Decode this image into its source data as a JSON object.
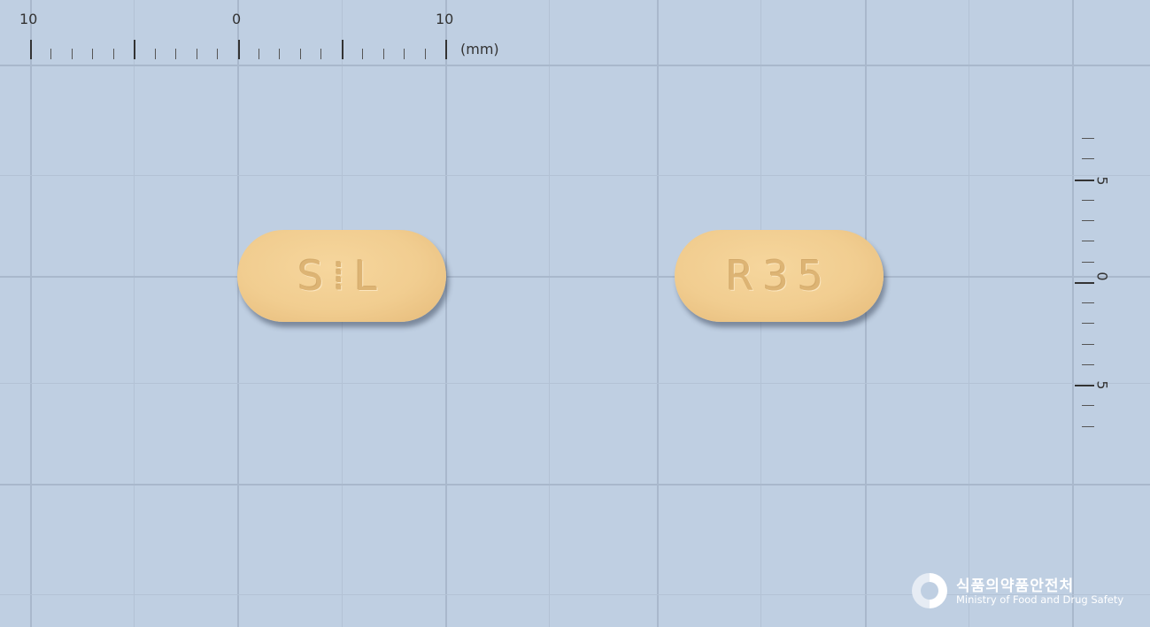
{
  "top_ruler": {
    "labels": [
      "10",
      "0",
      "10"
    ],
    "unit": "(mm)"
  },
  "right_ruler": {
    "labels": [
      "5",
      "0",
      "5"
    ]
  },
  "tablets": [
    {
      "imprint": "S⁞L"
    },
    {
      "imprint": "R35"
    }
  ],
  "logo": {
    "korean": "식품의약품안전처",
    "english": "Ministry of Food and Drug Safety"
  },
  "colors": {
    "background": "#bfcfe2",
    "tablet": "#f1cd90",
    "grid": "#a9b8cc"
  }
}
